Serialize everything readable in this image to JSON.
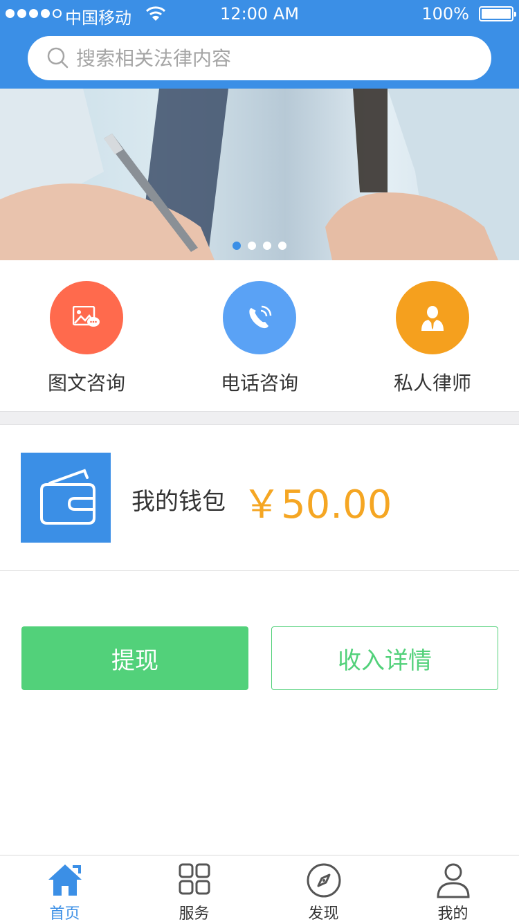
{
  "status_bar": {
    "carrier": "中国移动",
    "time": "12:00 AM",
    "battery": "100%"
  },
  "search": {
    "placeholder": "搜索相关法律内容"
  },
  "banner": {
    "page_count": 4,
    "active_page": 1
  },
  "quick_actions": [
    {
      "label": "图文咨询",
      "icon": "image-chat-icon",
      "color": "#ff6a4d"
    },
    {
      "label": "电话咨询",
      "icon": "phone-call-icon",
      "color": "#5aa2f5"
    },
    {
      "label": "私人律师",
      "icon": "lawyer-icon",
      "color": "#f5a01e"
    }
  ],
  "wallet": {
    "label": "我的钱包",
    "amount": "￥50.00"
  },
  "buttons": {
    "withdraw_label": "提现",
    "income_detail_label": "收入详情"
  },
  "tab_bar": [
    {
      "label": "首页",
      "icon": "home-icon",
      "active": true
    },
    {
      "label": "服务",
      "icon": "grid-icon",
      "active": false
    },
    {
      "label": "发现",
      "icon": "compass-icon",
      "active": false
    },
    {
      "label": "我的",
      "icon": "profile-icon",
      "active": false
    }
  ],
  "colors": {
    "primary": "#3b8fe6",
    "accent_green": "#52d17a",
    "amount_orange": "#f5a623"
  }
}
